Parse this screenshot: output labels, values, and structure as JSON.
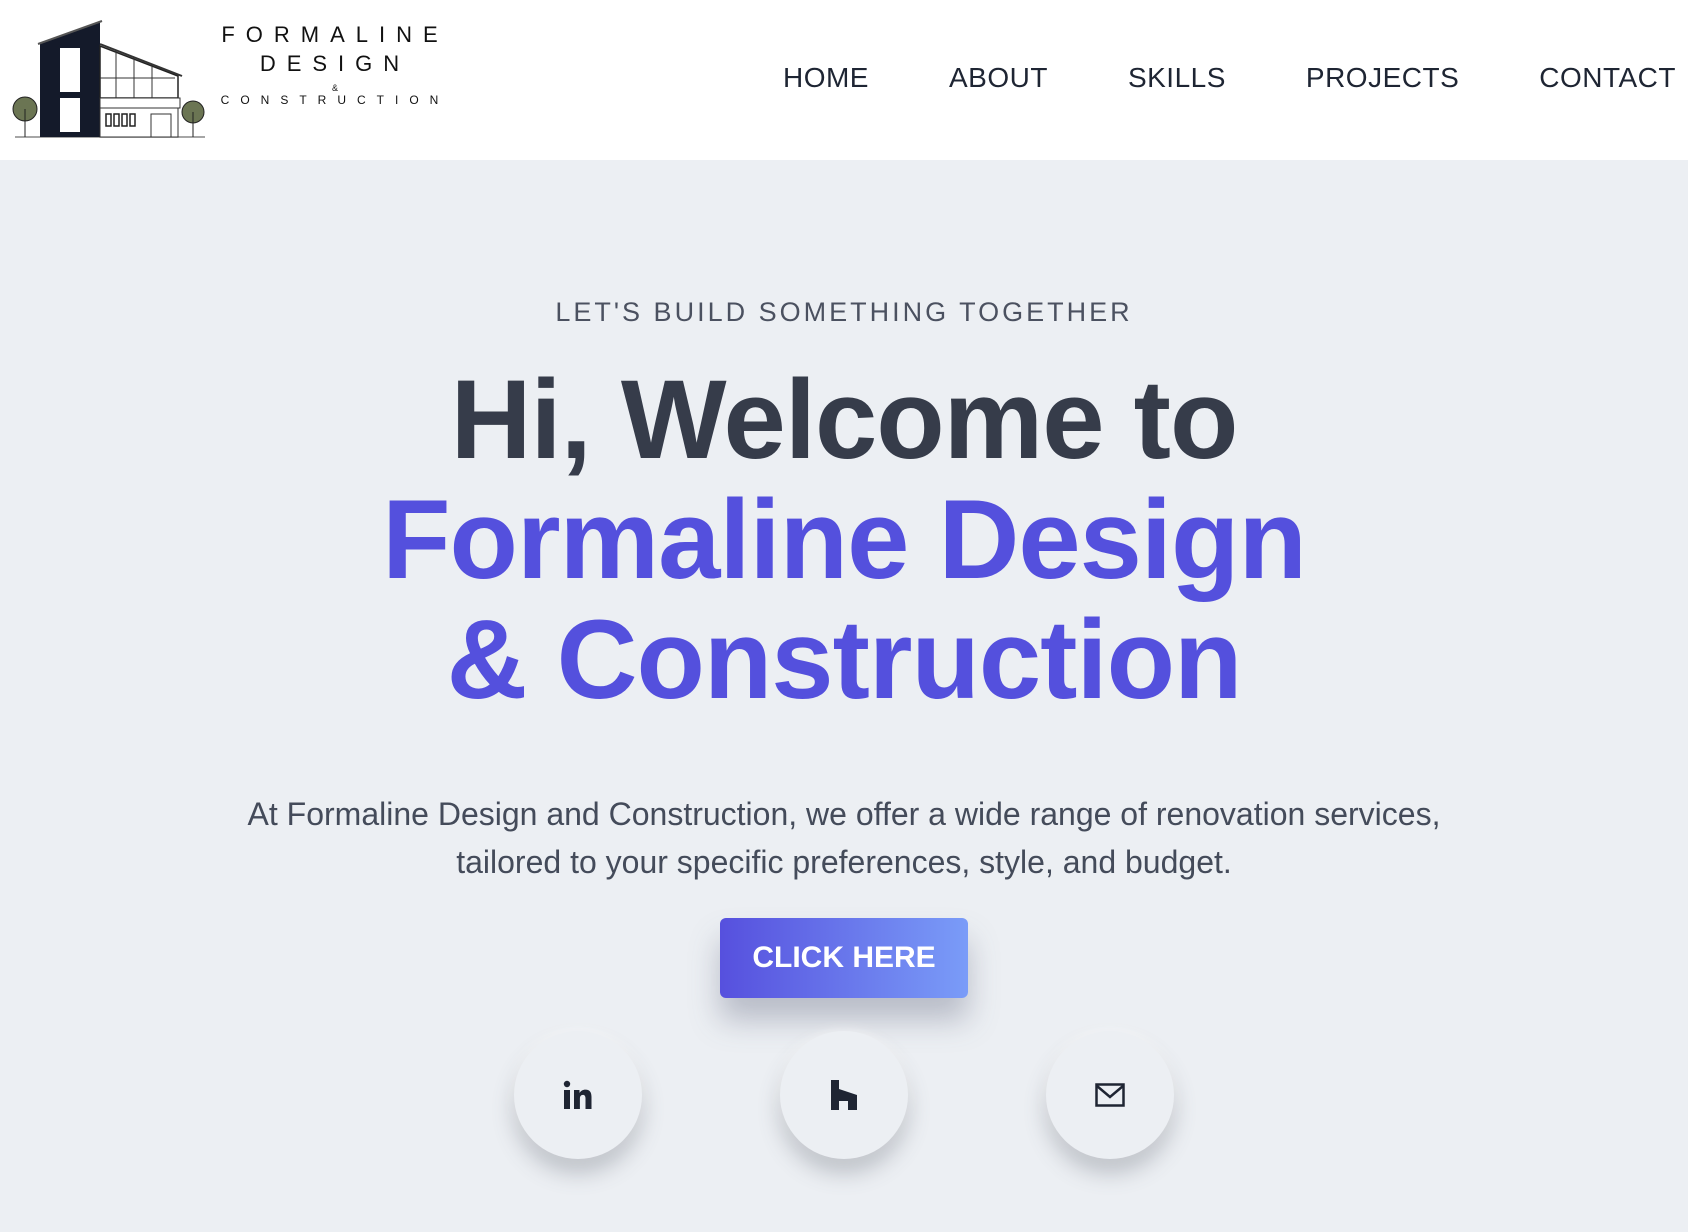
{
  "brand": {
    "line1": "FORMALINE",
    "line2": "DESIGN",
    "line3": "&",
    "line4": "CONSTRUCTION"
  },
  "nav": [
    {
      "label": "HOME"
    },
    {
      "label": "ABOUT"
    },
    {
      "label": "SKILLS"
    },
    {
      "label": "PROJECTS"
    },
    {
      "label": "CONTACT"
    }
  ],
  "hero": {
    "eyebrow": "LET'S BUILD SOMETHING TOGETHER",
    "title_line1": "Hi, Welcome to",
    "title_line2": "Formaline Design",
    "title_line3": "& Construction",
    "description": "At Formaline Design and Construction, we offer a wide range of renovation services, tailored to your specific preferences, style, and budget.",
    "cta": "CLICK HERE"
  },
  "social": [
    {
      "icon": "linkedin-icon"
    },
    {
      "icon": "houzz-icon"
    },
    {
      "icon": "mail-icon"
    }
  ],
  "colors": {
    "accent": "#5450dd",
    "heading": "#363c4a",
    "background": "#eceff3"
  }
}
